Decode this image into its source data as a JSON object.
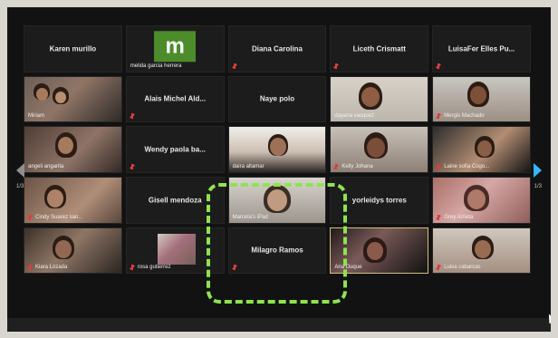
{
  "participants": {
    "t0": "Karen murillo",
    "t1": "melida garcia herrera",
    "t2": "Diana Carolina",
    "t3": "Liceth Crismatt",
    "t4": "LuisaFer Elles Pu...",
    "t5": "Miriam",
    "t6": "Alais Michel Ald...",
    "t7": "Naye polo",
    "t8": "dayana vasquez",
    "t9": "Mergis Machado",
    "t10": "angeli angarita",
    "t11": "Wendy paola ba...",
    "t12": "daira altamar",
    "t13": "Kelly Johana",
    "t14": "Laine sofia Cogo...",
    "t15": "Cindy Suarez san...",
    "t16": "Gisell mendoza",
    "t17": "Marcela's iPad",
    "t18": "yorleidys torres",
    "t19": "Grey Arrieta",
    "t20": "Kiara Lozada",
    "t21": "rosa gutierrez",
    "t22": "Milagro Ramos",
    "t23": "Ana Duque",
    "t24": "Luisa cabarcas"
  },
  "avatar_letter": "m",
  "pagination": {
    "left": "1/3",
    "right": "1/3"
  }
}
